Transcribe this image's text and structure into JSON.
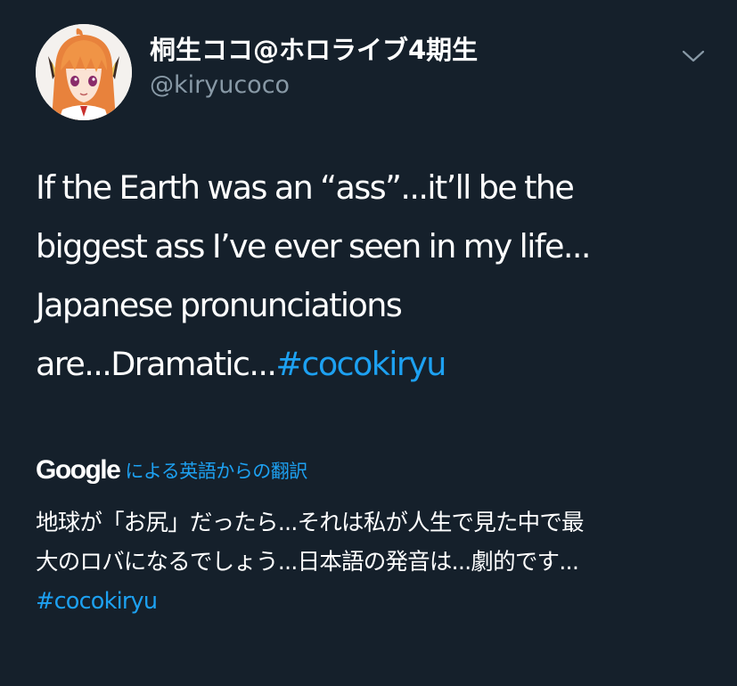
{
  "user": {
    "display_name": "桐生ココ@ホロライブ4期生",
    "handle": "@kiryucoco",
    "avatar_icon": "user-avatar"
  },
  "menu": {
    "chevron_icon": "chevron-down-icon"
  },
  "tweet": {
    "lines": [
      "If the Earth was an “ass”...it’ll be the",
      "biggest ass I’ve ever seen in my life...",
      "Japanese pronunciations"
    ],
    "last_line_text": "are...Dramatic...",
    "hashtag": "#cocokiryu"
  },
  "translation": {
    "provider": "Google",
    "label": "による英語からの翻訳",
    "lines": [
      "地球が「お尻」だったら...それは私が人生で見た中で最",
      "大のロバになるでしょう...日本語の発音は...劇的です..."
    ],
    "hashtag": "#cocokiryu"
  },
  "colors": {
    "background": "#15202b",
    "text": "#ffffff",
    "secondary": "#8899a6",
    "accent": "#1da1f2"
  }
}
